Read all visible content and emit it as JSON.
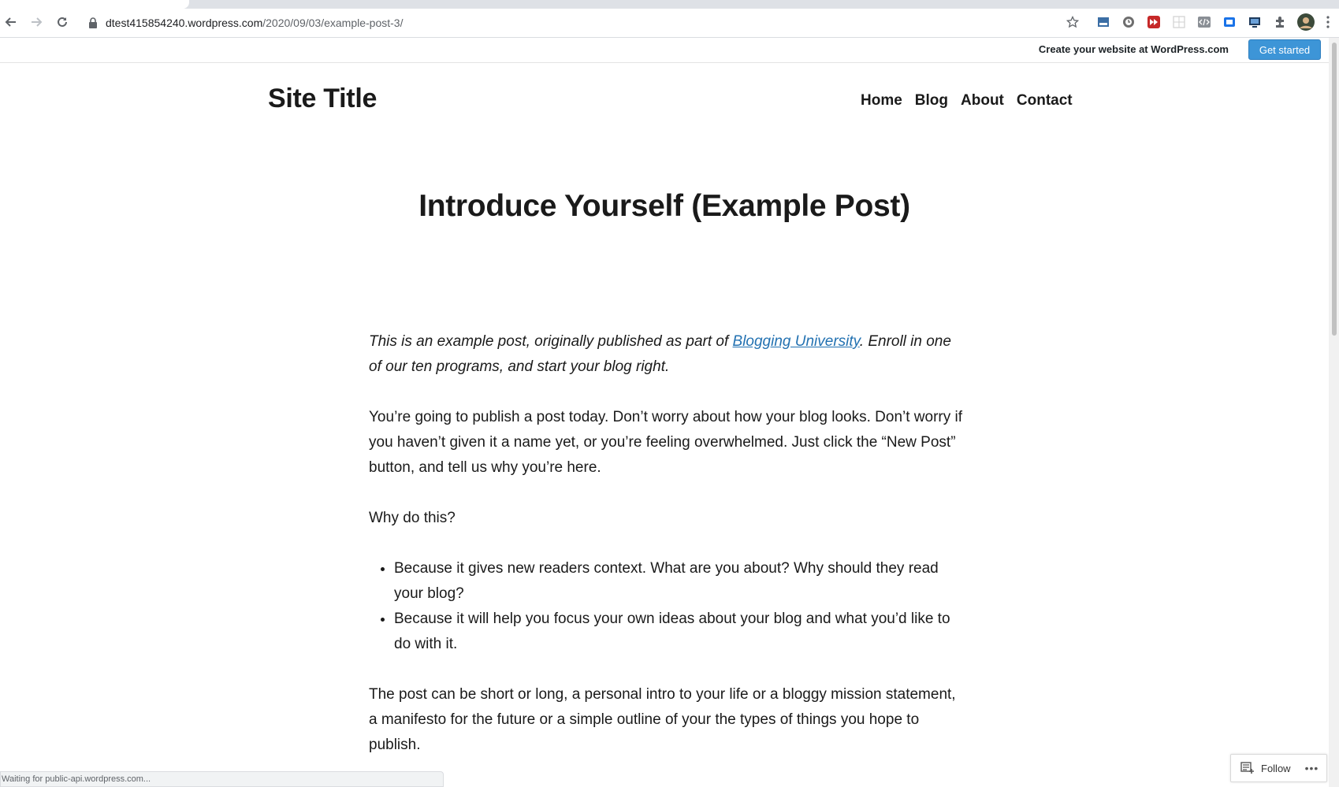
{
  "browser": {
    "url_host": "dtest415854240.wordpress.com",
    "url_path": "/2020/09/03/example-post-3/",
    "status_text": "Waiting for public-api.wordpress.com..."
  },
  "wp_bar": {
    "cta_text": "Create your website at WordPress.com",
    "cta_button": "Get started"
  },
  "site": {
    "title": "Site Title",
    "nav": [
      "Home",
      "Blog",
      "About",
      "Contact"
    ]
  },
  "post": {
    "title": "Introduce Yourself (Example Post)",
    "intro_before_link": "This is an example post, originally published as part of ",
    "intro_link": "Blogging University",
    "intro_after_link": ". Enroll in one of our ten programs, and start your blog right.",
    "paragraph_1": "You’re going to publish a post today. Don’t worry about how your blog looks. Don’t worry if you haven’t given it a name yet, or you’re feeling overwhelmed. Just click the “New Post” button, and tell us why you’re here.",
    "paragraph_2": "Why do this?",
    "bullets": [
      "Because it gives new readers context. What are you about? Why should they read your blog?",
      "Because it will help you focus your own ideas about your blog and what you’d like to do with it."
    ],
    "paragraph_3": "The post can be short or long, a personal intro to your life or a bloggy mission statement, a manifesto for the future or a simple outline of your the types of things you hope to publish."
  },
  "follow": {
    "label": "Follow"
  },
  "icons": {
    "back": "arrow-left-icon",
    "forward": "arrow-right-icon",
    "reload": "reload-icon",
    "lock": "lock-icon",
    "star": "star-icon",
    "extensions": "puzzle-icon",
    "menu": "kebab-menu-icon"
  },
  "colors": {
    "link": "#2271b1",
    "cta_button": "#3d95d7"
  }
}
